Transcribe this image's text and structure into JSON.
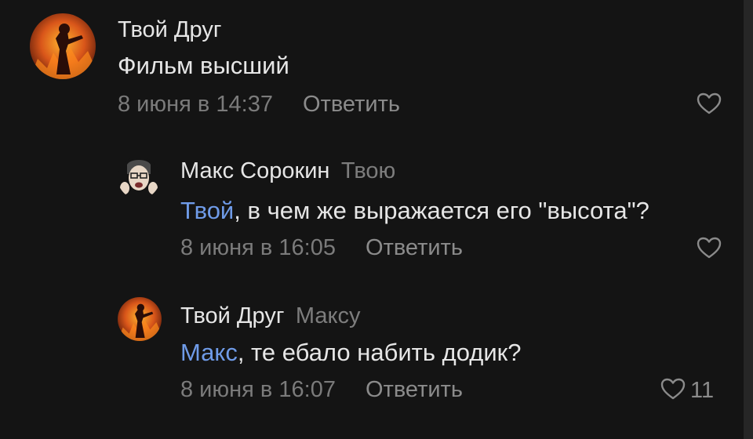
{
  "comments": [
    {
      "author": "Твой Друг",
      "reply_to": "",
      "mention": "",
      "text": "Фильм высший",
      "date": "8 июня в 14:37",
      "reply_label": "Ответить",
      "likes": ""
    },
    {
      "author": "Макс Сорокин",
      "reply_to": "Твою",
      "mention": "Твой",
      "text": ", в чем же выражается его \"высота\"?",
      "date": "8 июня в 16:05",
      "reply_label": "Ответить",
      "likes": ""
    },
    {
      "author": "Твой Друг",
      "reply_to": "Максу",
      "mention": "Макс",
      "text": ", те ебало набить додик?",
      "date": "8 июня в 16:07",
      "reply_label": "Ответить",
      "likes": "11"
    }
  ],
  "colors": {
    "background": "#141414",
    "text": "#e6e6e6",
    "muted": "#7b7b7b",
    "mention": "#6f9be8"
  },
  "icons": {
    "like": "heart-outline-icon"
  }
}
